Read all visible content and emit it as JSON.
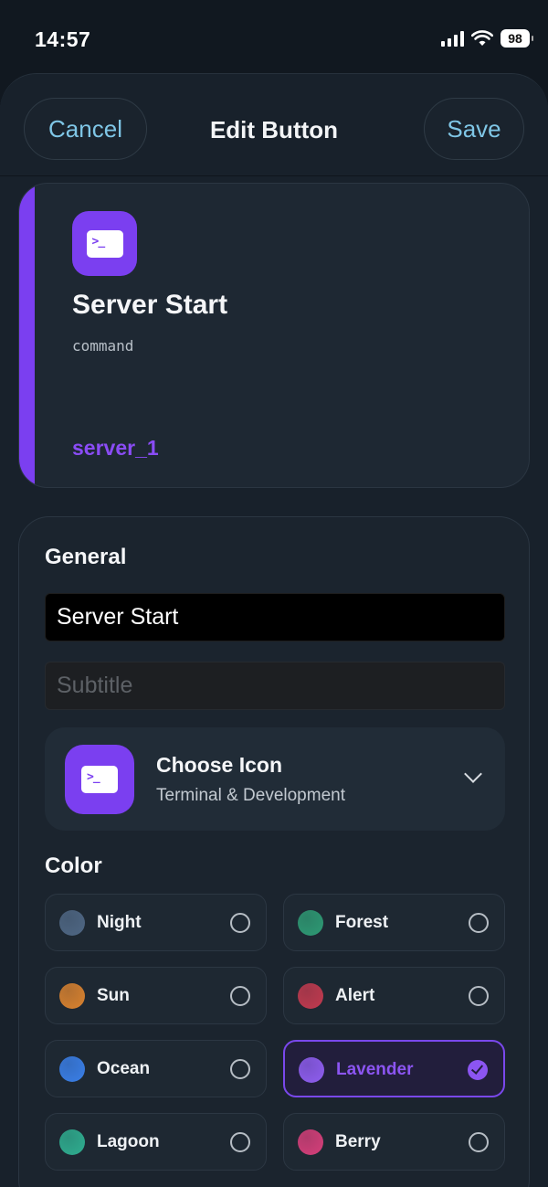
{
  "status_bar": {
    "time": "14:57",
    "battery": "98"
  },
  "nav": {
    "cancel_label": "Cancel",
    "title": "Edit Button",
    "save_label": "Save"
  },
  "preview": {
    "icon": "terminal-icon",
    "title": "Server Start",
    "subtitle": "command",
    "tag": "server_1",
    "accent_color": "#7b3ff0"
  },
  "form": {
    "general_label": "General",
    "title_value": "Server Start",
    "subtitle_placeholder": "Subtitle",
    "icon_picker": {
      "title": "Choose Icon",
      "category": "Terminal & Development",
      "icon": "terminal-icon"
    },
    "color_label": "Color",
    "colors": [
      {
        "name": "Night",
        "swatch": "#4f6784",
        "selected": false
      },
      {
        "name": "Forest",
        "swatch": "#2e9a74",
        "selected": false
      },
      {
        "name": "Sun",
        "swatch": "#d9822f",
        "selected": false
      },
      {
        "name": "Alert",
        "swatch": "#c23a4f",
        "selected": false
      },
      {
        "name": "Ocean",
        "swatch": "#3a7fe8",
        "selected": false
      },
      {
        "name": "Lavender",
        "swatch": "#8f5ef0",
        "selected": true
      },
      {
        "name": "Lagoon",
        "swatch": "#2fae90",
        "selected": false
      },
      {
        "name": "Berry",
        "swatch": "#d63f7a",
        "selected": false
      }
    ]
  }
}
